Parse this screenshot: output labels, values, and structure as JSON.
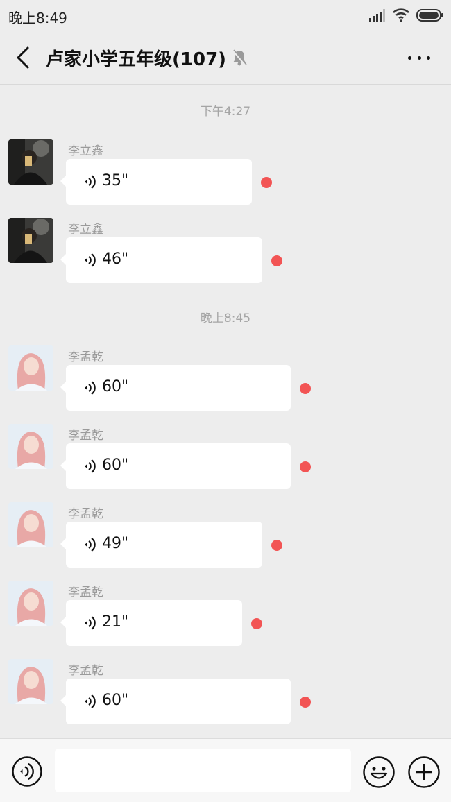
{
  "status": {
    "time": "晚上8:49"
  },
  "header": {
    "title": "卢家小学五年级(107)"
  },
  "timestamps": [
    "下午4:27",
    "晚上8:45"
  ],
  "messages": [
    {
      "sender": "李立鑫",
      "duration": "35\""
    },
    {
      "sender": "李立鑫",
      "duration": "46\""
    },
    {
      "sender": "李孟乾",
      "duration": "60\""
    },
    {
      "sender": "李孟乾",
      "duration": "60\""
    },
    {
      "sender": "李孟乾",
      "duration": "49\""
    },
    {
      "sender": "李孟乾",
      "duration": "21\""
    },
    {
      "sender": "李孟乾",
      "duration": "60\""
    }
  ],
  "colors": {
    "unread": "#f25454",
    "background": "#ededed",
    "bubble": "#ffffff"
  },
  "icons": [
    "back-arrow-icon",
    "mute-bell-icon",
    "more-dots-icon",
    "voice-wave-icon",
    "emoji-icon",
    "plus-icon",
    "signal-icon",
    "wifi-icon",
    "battery-icon"
  ]
}
